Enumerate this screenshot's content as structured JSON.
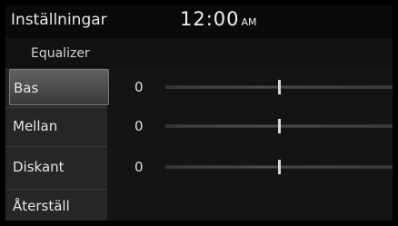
{
  "header": {
    "title": "Inställningar",
    "time": "12:00",
    "ampm": "AM"
  },
  "subtitle": "Equalizer",
  "rows": [
    {
      "label": "Bas",
      "value": "0",
      "level": 0.5
    },
    {
      "label": "Mellan",
      "value": "0",
      "level": 0.5
    },
    {
      "label": "Diskant",
      "value": "0",
      "level": 0.5
    }
  ],
  "reset": {
    "label": "Återställ"
  }
}
